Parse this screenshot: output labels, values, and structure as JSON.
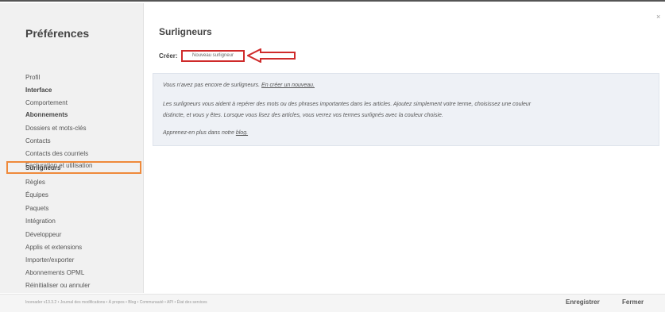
{
  "sidebar": {
    "title": "Préférences",
    "items": [
      {
        "label": "Profil"
      },
      {
        "label": "Interface"
      },
      {
        "label": "Comportement"
      },
      {
        "label": "Abonnements"
      },
      {
        "label": "Dossiers et mots-clés"
      },
      {
        "label": "Contacts"
      },
      {
        "label": "Contacts des courriels"
      },
      {
        "label": "Facturation et utilisation"
      },
      {
        "label": "Surligneurs"
      },
      {
        "label": "Règles"
      },
      {
        "label": "Équipes"
      },
      {
        "label": "Paquets"
      },
      {
        "label": "Intégration"
      },
      {
        "label": "Développeur"
      },
      {
        "label": "Applis et extensions"
      },
      {
        "label": "Importer/exporter"
      },
      {
        "label": "Abonnements OPML"
      },
      {
        "label": "Réinitialiser ou annuler"
      }
    ],
    "selected": "Surligneurs"
  },
  "main": {
    "title": "Surligneurs",
    "create_label": "Créer:",
    "new_button_label": "Nouveau surligneur",
    "info": {
      "empty_text": "Vous n'avez pas encore de surligneurs.",
      "empty_link": "En créer un nouveau.",
      "description_line1": "Les surligneurs vous aident à repérer des mots ou des phrases importantes dans les articles. Ajoutez simplement votre terme, choisissez une couleur",
      "description_line2": "distincte, et vous y êtes. Lorsque vous lisez des articles, vous verrez vos termes surlignés avec la couleur choisie.",
      "learn_more_text": "Apprenez-en plus dans notre",
      "learn_more_link": "blog."
    }
  },
  "footer": {
    "text": "Inoreader v13.3.2 • Journal des modifications • À propos • Blog • Communauté • API • État des services",
    "save_label": "Enregistrer",
    "close_label": "Fermer"
  },
  "colors": {
    "highlight_orange": "#ef8a3b",
    "annotation_red": "#cf2b2b",
    "panel_bg": "#eef1f6"
  }
}
